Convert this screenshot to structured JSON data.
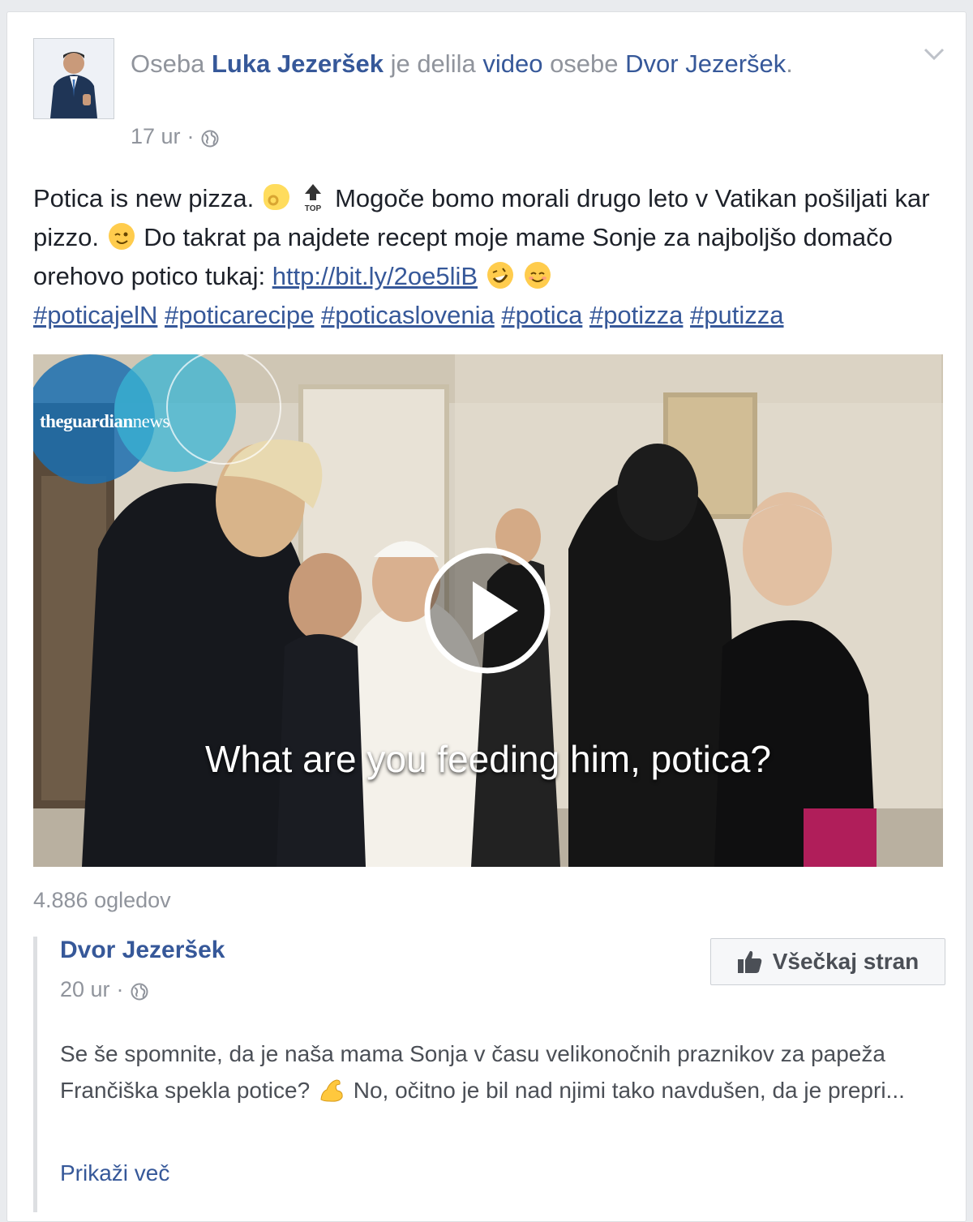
{
  "header": {
    "prefix": "Oseba",
    "author": "Luka Jezeršek",
    "action": "je delila",
    "shared_type": "video",
    "shared_from_prefix": "osebe",
    "shared_from": "Dvor Jezeršek",
    "suffix": ".",
    "time": "17 ur",
    "separator": "·"
  },
  "post": {
    "text_1": "Potica is new pizza.",
    "text_2": "Mogoče bomo morali drugo leto v Vatikan pošiljati kar pizzo.",
    "text_3": "Do takrat pa najdete recept moje mame Sonje za najboljšo domačo orehovo potico tukaj:",
    "link": "http://bit.ly/2oe5liB",
    "hashtags": [
      "#poticajelN",
      "#poticarecipe",
      "#poticaslovenia",
      "#potica",
      "#potizza",
      "#putizza"
    ],
    "top_label": "TOP"
  },
  "video": {
    "logo_main": "theguardian",
    "logo_suffix": "news",
    "subtitle": "What are you feeding him, potica?"
  },
  "views": "4.886 ogledov",
  "shared": {
    "page_name": "Dvor Jezeršek",
    "time": "20 ur",
    "separator": "·",
    "like_button": "Všečkaj stran",
    "text_1": "Se še spomnite, da je naša mama Sonja v času velikonočnih praznikov za papeža Frančiška spekla potice?",
    "text_2": "No, očitno je bil nad njimi tako navdušen, da je prepri...",
    "see_more": "Prikaži več"
  },
  "colors": {
    "link": "#365899",
    "meta": "#90949c",
    "text": "#1d2129"
  }
}
